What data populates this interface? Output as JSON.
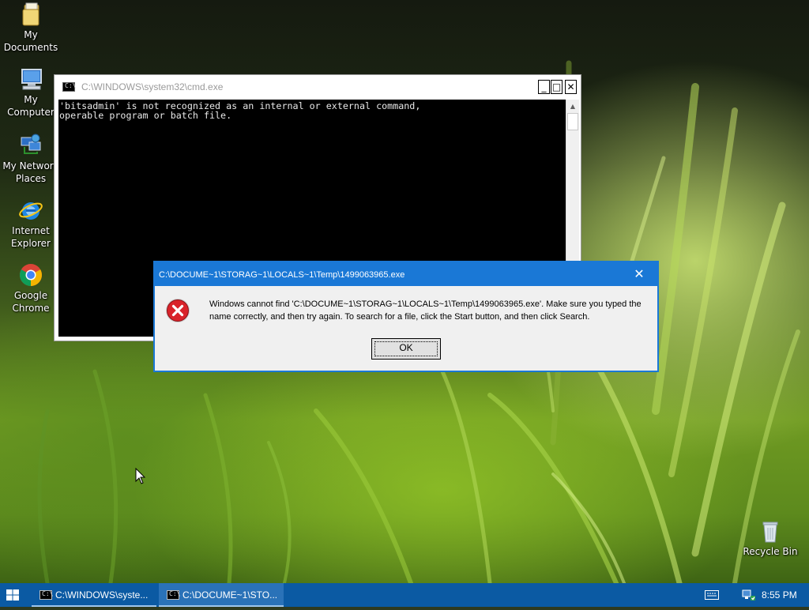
{
  "desktop": {
    "icons": [
      {
        "label": "My\nDocuments",
        "icon": "folder-icon"
      },
      {
        "label": "My Computer",
        "icon": "computer-icon"
      },
      {
        "label": "My Network\nPlaces",
        "icon": "network-icon"
      },
      {
        "label": "Internet\nExplorer",
        "icon": "ie-icon"
      },
      {
        "label": "Google\nChrome",
        "icon": "chrome-icon"
      },
      {
        "label": "Recycle Bin",
        "icon": "recycle-bin-icon"
      }
    ]
  },
  "cmd_window": {
    "title": "C:\\WINDOWS\\system32\\cmd.exe",
    "icon_text": "C:\\",
    "minimize": "_",
    "maximize": "□",
    "close": "✕",
    "output": "'bitsadmin' is not recognized as an internal or external command,\noperable program or batch file."
  },
  "error_dialog": {
    "title": "C:\\DOCUME~1\\STORAG~1\\LOCALS~1\\Temp\\1499063965.exe",
    "close": "✕",
    "message": "Windows cannot find 'C:\\DOCUME~1\\STORAG~1\\LOCALS~1\\Temp\\1499063965.exe'. Make sure you typed the name correctly, and then try again. To search for a file, click the Start button, and then click Search.",
    "ok_label": "OK"
  },
  "taskbar": {
    "tasks": [
      {
        "label": "C:\\WINDOWS\\syste...",
        "icon_text": "C:\\",
        "active": false
      },
      {
        "label": "C:\\DOCUME~1\\STO...",
        "icon_text": "C:\\",
        "active": true
      }
    ],
    "clock": "8:55 PM"
  },
  "colors": {
    "taskbar": "#0b5aa3",
    "dialog_accent": "#1a78d6",
    "error_red": "#d9232a"
  }
}
